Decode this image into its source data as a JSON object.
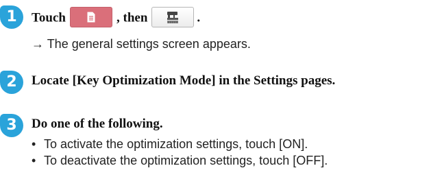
{
  "steps": [
    {
      "badge": "1",
      "heading_before": "Touch",
      "heading_middle": ", then",
      "heading_after": ".",
      "buttons": [
        {
          "icon": "page-document-icon",
          "color": "#da6f7a"
        },
        {
          "icon": "sewing-machine-settings-icon",
          "color": "#f0f0f0"
        }
      ],
      "result_arrow": "→",
      "result_text": "The general settings screen appears."
    },
    {
      "badge": "2",
      "heading": "Locate [Key Optimization Mode] in the Settings pages."
    },
    {
      "badge": "3",
      "heading": "Do one of the following.",
      "bullet_char": "•",
      "bullets": [
        "To activate the optimization settings, touch [ON].",
        "To deactivate the optimization settings, touch [OFF]."
      ]
    }
  ],
  "colors": {
    "badge": "#2aa3da",
    "page_button": "#da6f7a"
  }
}
